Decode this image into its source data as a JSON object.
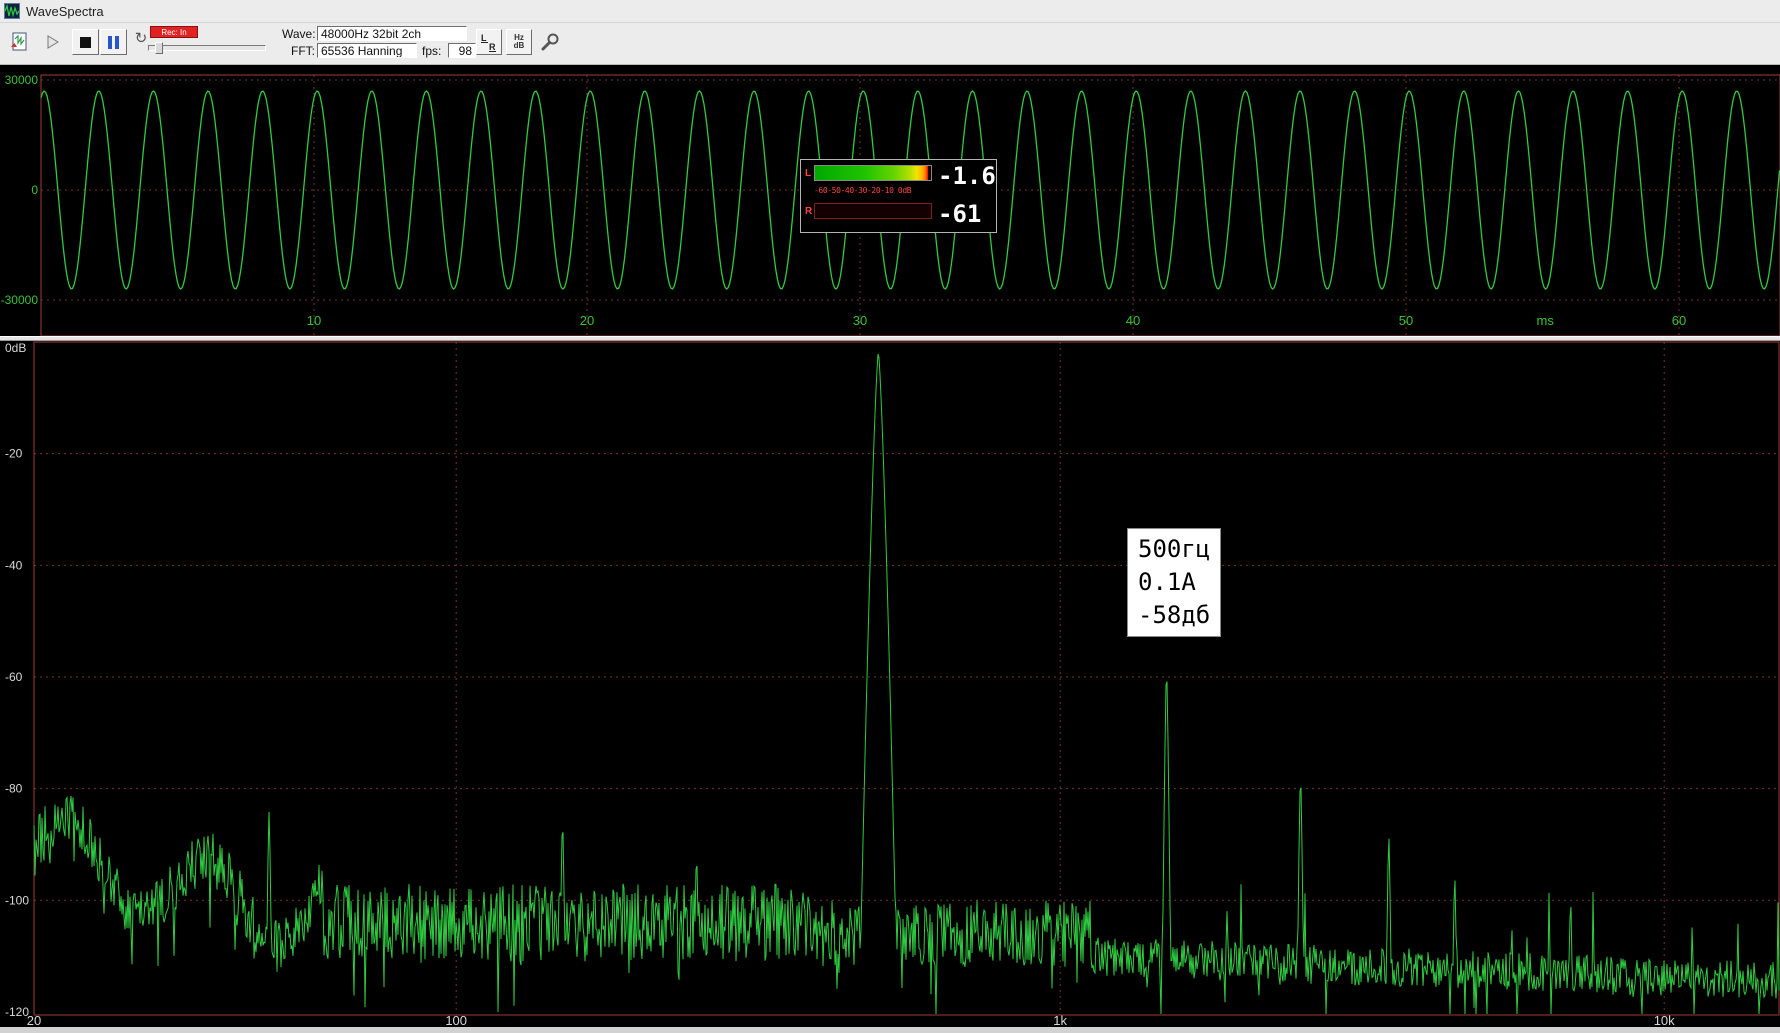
{
  "window": {
    "title": "WaveSpectra"
  },
  "toolbar": {
    "rec_badge": "Rec: In",
    "wave_label": "Wave:",
    "wave_value": "48000Hz 32bit 2ch",
    "fft_label": "FFT:",
    "fft_value": "65536 Hanning",
    "fps_label": "fps:",
    "fps_value": "98",
    "lr_button": "L R",
    "hz_label": "Hz",
    "db_label": "dB"
  },
  "meter": {
    "left_label": "L",
    "right_label": "R",
    "left_value": "-1.6",
    "right_value": "-61",
    "left_level_db": -1.6,
    "right_level_db": -61,
    "range_db": 60,
    "scale_text": "-60-50-40-30-20-10 0dB"
  },
  "annotation": {
    "line1": "500гц",
    "line2": "0.1A",
    "line3": "-58дб"
  },
  "colors": {
    "trace": "#2ecc40",
    "grid": "#7a2f2f",
    "border": "#a23c3c",
    "wave_axis_text": "#35c435",
    "spec_axis_text": "#d8d8d8"
  },
  "chart_data": [
    {
      "type": "line",
      "name": "oscilloscope-waveform",
      "x_unit": "ms",
      "xlim_ms": [
        0,
        63.7
      ],
      "x_ticks": [
        {
          "label": "10",
          "ms": 10
        },
        {
          "label": "20",
          "ms": 20
        },
        {
          "label": "30",
          "ms": 30
        },
        {
          "label": "40",
          "ms": 40
        },
        {
          "label": "50",
          "ms": 50
        },
        {
          "label": "60",
          "ms": 60
        }
      ],
      "unit_label_at_ms": 55.1,
      "ylim": [
        -30000,
        30000
      ],
      "y_ticks": [
        {
          "label": "30000",
          "v": 30000
        },
        {
          "label": "0",
          "v": 0
        },
        {
          "label": "-30000",
          "v": -30000
        }
      ],
      "signal": {
        "shape": "sine",
        "frequency_hz": 500,
        "amplitude": 27000
      }
    },
    {
      "type": "line",
      "name": "fft-spectrum",
      "x_scale": "log",
      "xlim_hz": [
        20,
        16000
      ],
      "x_ticks": [
        {
          "label": "20",
          "hz": 20
        },
        {
          "label": "100",
          "hz": 100
        },
        {
          "label": "1k",
          "hz": 1000
        },
        {
          "label": "10k",
          "hz": 10000
        }
      ],
      "ylim_db": [
        -120,
        0
      ],
      "y_ticks": [
        {
          "label": "0dB",
          "db": 0
        },
        {
          "label": "-20",
          "db": -20
        },
        {
          "label": "-40",
          "db": -40
        },
        {
          "label": "-60",
          "db": -60
        },
        {
          "label": "-80",
          "db": -80
        },
        {
          "label": "-100",
          "db": -100
        },
        {
          "label": "-120",
          "db": -120
        }
      ],
      "noise_floor_db": -106,
      "peaks": [
        {
          "hz": 49,
          "db": -84,
          "sharpness": 8
        },
        {
          "hz": 150,
          "db": -85,
          "sharpness": 8
        },
        {
          "hz": 250,
          "db": -91,
          "sharpness": 8
        },
        {
          "hz": 500,
          "db": -1.6,
          "sharpness": 2.2
        },
        {
          "hz": 1000,
          "db": -100,
          "sharpness": 8
        },
        {
          "hz": 1500,
          "db": -58,
          "sharpness": 8
        },
        {
          "hz": 2500,
          "db": -77,
          "sharpness": 8
        },
        {
          "hz": 3500,
          "db": -88,
          "sharpness": 8
        },
        {
          "hz": 4500,
          "db": -95,
          "sharpness": 8
        },
        {
          "hz": 7000,
          "db": -99,
          "sharpness": 8
        }
      ]
    }
  ]
}
